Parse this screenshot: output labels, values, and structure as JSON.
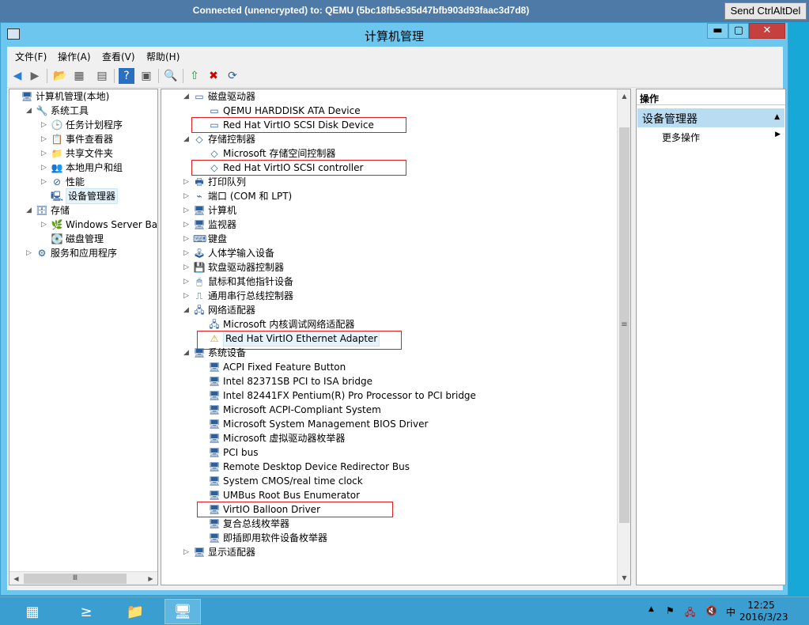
{
  "vnc": {
    "title": "Connected (unencrypted) to: QEMU (5bc18fb5e35d47bfb903d93faac3d7d8)",
    "send_label": "Send CtrlAltDel"
  },
  "window": {
    "title": "计算机管理",
    "min": "▬",
    "max": "▢",
    "close": "✕"
  },
  "menu": [
    "文件(F)",
    "操作(A)",
    "查看(V)",
    "帮助(H)"
  ],
  "left_tree": [
    {
      "label": "计算机管理(本地)",
      "exp": "",
      "icon": "computer-management-icon",
      "glyph": "🖥",
      "level": 0
    },
    {
      "label": "系统工具",
      "exp": "◢",
      "icon": "system-tools-icon",
      "glyph": "🔧",
      "level": 1
    },
    {
      "label": "任务计划程序",
      "exp": "▷",
      "icon": "task-scheduler-icon",
      "glyph": "🕒",
      "level": 2
    },
    {
      "label": "事件查看器",
      "exp": "▷",
      "icon": "event-viewer-icon",
      "glyph": "📋",
      "level": 2
    },
    {
      "label": "共享文件夹",
      "exp": "▷",
      "icon": "shared-folders-icon",
      "glyph": "📁",
      "level": 2
    },
    {
      "label": "本地用户和组",
      "exp": "▷",
      "icon": "users-groups-icon",
      "glyph": "👥",
      "level": 2
    },
    {
      "label": "性能",
      "exp": "▷",
      "icon": "performance-icon",
      "glyph": "⊘",
      "level": 2
    },
    {
      "label": "设备管理器",
      "exp": "",
      "icon": "device-manager-icon",
      "glyph": "🖳",
      "level": 2,
      "selected": true
    },
    {
      "label": "存储",
      "exp": "◢",
      "icon": "storage-icon",
      "glyph": "🗄",
      "level": 1
    },
    {
      "label": "Windows Server Back",
      "exp": "▷",
      "icon": "backup-icon",
      "glyph": "🌿",
      "level": 2
    },
    {
      "label": "磁盘管理",
      "exp": "",
      "icon": "disk-management-icon",
      "glyph": "💽",
      "level": 2
    },
    {
      "label": "服务和应用程序",
      "exp": "▷",
      "icon": "services-apps-icon",
      "glyph": "⚙",
      "level": 1
    }
  ],
  "device_tree": [
    {
      "label": "磁盘驱动器",
      "exp": "◢",
      "icon": "disk-drive-icon",
      "glyph": "▭",
      "level": 0
    },
    {
      "label": "QEMU HARDDISK ATA Device",
      "exp": "",
      "icon": "disk-drive-icon",
      "glyph": "▭",
      "level": 1
    },
    {
      "label": "Red Hat VirtIO SCSI Disk Device",
      "exp": "",
      "icon": "disk-drive-icon",
      "glyph": "▭",
      "level": 1,
      "highlight": true
    },
    {
      "label": "存储控制器",
      "exp": "◢",
      "icon": "storage-controller-icon",
      "glyph": "◇",
      "level": 0
    },
    {
      "label": "Microsoft 存储空间控制器",
      "exp": "",
      "icon": "storage-controller-icon",
      "glyph": "◇",
      "level": 1
    },
    {
      "label": "Red Hat VirtIO SCSI controller",
      "exp": "",
      "icon": "storage-controller-icon",
      "glyph": "◇",
      "level": 1,
      "highlight": true
    },
    {
      "label": "打印队列",
      "exp": "▷",
      "icon": "printer-icon",
      "glyph": "🖶",
      "level": 0
    },
    {
      "label": "端口 (COM 和 LPT)",
      "exp": "▷",
      "icon": "port-icon",
      "glyph": "⌁",
      "level": 0
    },
    {
      "label": "计算机",
      "exp": "▷",
      "icon": "computer-icon",
      "glyph": "🖥",
      "level": 0
    },
    {
      "label": "监视器",
      "exp": "▷",
      "icon": "monitor-icon",
      "glyph": "🖥",
      "level": 0
    },
    {
      "label": "键盘",
      "exp": "▷",
      "icon": "keyboard-icon",
      "glyph": "⌨",
      "level": 0
    },
    {
      "label": "人体学输入设备",
      "exp": "▷",
      "icon": "hid-icon",
      "glyph": "🕹",
      "level": 0
    },
    {
      "label": "软盘驱动器控制器",
      "exp": "▷",
      "icon": "floppy-controller-icon",
      "glyph": "💾",
      "level": 0
    },
    {
      "label": "鼠标和其他指针设备",
      "exp": "▷",
      "icon": "mouse-icon",
      "glyph": "🖱",
      "level": 0
    },
    {
      "label": "通用串行总线控制器",
      "exp": "▷",
      "icon": "usb-icon",
      "glyph": "⎍",
      "level": 0
    },
    {
      "label": "网络适配器",
      "exp": "◢",
      "icon": "network-adapter-icon",
      "glyph": "🖧",
      "level": 0
    },
    {
      "label": "Microsoft 内核调试网络适配器",
      "exp": "",
      "icon": "network-adapter-icon",
      "glyph": "🖧",
      "level": 1
    },
    {
      "label": "Red Hat VirtIO Ethernet Adapter",
      "exp": "",
      "icon": "network-adapter-warning-icon",
      "glyph": "⚠",
      "level": 1,
      "highlight": true,
      "selected": true
    },
    {
      "label": "系统设备",
      "exp": "◢",
      "icon": "system-device-icon",
      "glyph": "🖥",
      "level": 0
    },
    {
      "label": "ACPI Fixed Feature Button",
      "exp": "",
      "icon": "system-device-icon",
      "glyph": "🖥",
      "level": 1
    },
    {
      "label": "Intel 82371SB PCI to ISA bridge",
      "exp": "",
      "icon": "system-device-icon",
      "glyph": "🖥",
      "level": 1
    },
    {
      "label": "Intel 82441FX Pentium(R) Pro Processor to PCI bridge",
      "exp": "",
      "icon": "system-device-icon",
      "glyph": "🖥",
      "level": 1
    },
    {
      "label": "Microsoft ACPI-Compliant System",
      "exp": "",
      "icon": "system-device-icon",
      "glyph": "🖥",
      "level": 1
    },
    {
      "label": "Microsoft System Management BIOS Driver",
      "exp": "",
      "icon": "system-device-icon",
      "glyph": "🖥",
      "level": 1
    },
    {
      "label": "Microsoft 虚拟驱动器枚举器",
      "exp": "",
      "icon": "system-device-icon",
      "glyph": "🖥",
      "level": 1
    },
    {
      "label": "PCI bus",
      "exp": "",
      "icon": "system-device-icon",
      "glyph": "🖥",
      "level": 1
    },
    {
      "label": "Remote Desktop Device Redirector Bus",
      "exp": "",
      "icon": "system-device-icon",
      "glyph": "🖥",
      "level": 1
    },
    {
      "label": "System CMOS/real time clock",
      "exp": "",
      "icon": "system-device-icon",
      "glyph": "🖥",
      "level": 1
    },
    {
      "label": "UMBus Root Bus Enumerator",
      "exp": "",
      "icon": "system-device-icon",
      "glyph": "🖥",
      "level": 1
    },
    {
      "label": "VirtIO Balloon Driver",
      "exp": "",
      "icon": "system-device-icon",
      "glyph": "🖥",
      "level": 1,
      "highlight": true
    },
    {
      "label": "复合总线枚举器",
      "exp": "",
      "icon": "system-device-icon",
      "glyph": "🖥",
      "level": 1
    },
    {
      "label": "即插即用软件设备枚举器",
      "exp": "",
      "icon": "system-device-icon",
      "glyph": "🖥",
      "level": 1
    },
    {
      "label": "显示适配器",
      "exp": "▷",
      "icon": "display-adapter-icon",
      "glyph": "🖥",
      "level": 0
    }
  ],
  "actions": {
    "header": "操作",
    "section": "设备管理器",
    "more": "更多操作"
  },
  "clock": {
    "time": "12:25",
    "date": "2016/3/23"
  },
  "tray": {
    "ime": "中"
  },
  "colors": {
    "highlight_border": "#e02020",
    "desktop": "#18a8d8",
    "window_frame": "#6cc6ee"
  }
}
